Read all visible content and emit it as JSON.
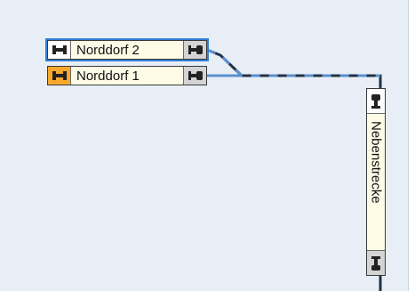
{
  "tracks": [
    {
      "label": "Norddorf 2",
      "selected": true
    },
    {
      "label": "Norddorf 1",
      "selected": false
    }
  ],
  "side_track": {
    "label": "Nebenstrecke"
  },
  "icons": {
    "buffer_stop": "buffer-stop-icon",
    "track_end": "track-end-icon"
  },
  "colors": {
    "canvas": "#e8eef6",
    "selection": "#2f7fd3",
    "label_bg": "#fdfbe6",
    "cap_orange": "#f7a82c",
    "line_dark": "#233246",
    "line_blue": "#5b8fce"
  }
}
